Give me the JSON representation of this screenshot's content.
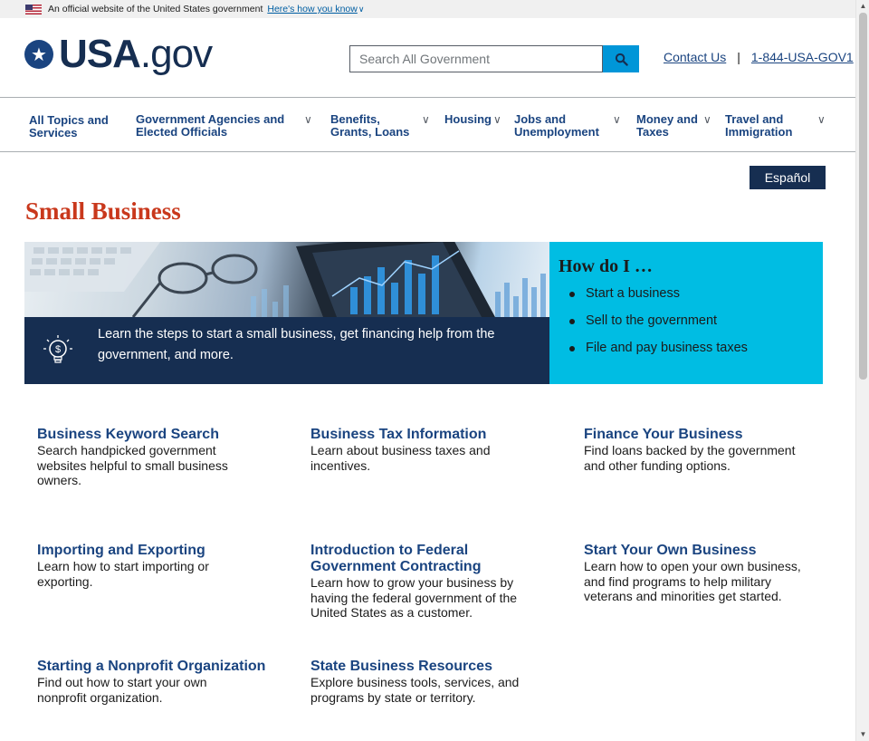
{
  "gov_banner": {
    "text": "An official website of the United States government",
    "link": "Here's how you know",
    "chevron_icon": "chevron-down-icon"
  },
  "header": {
    "logo_main": "USA",
    "logo_suffix": ".gov",
    "logo_icon": "star-circle-icon",
    "search": {
      "placeholder": "Search All Government",
      "value": "",
      "icon": "search-icon"
    },
    "contact_us": "Contact Us",
    "separator": "|",
    "phone": "1-844-USA-GOV1"
  },
  "nav": {
    "items": [
      {
        "label_line1": "All Topics and",
        "label_line2": "Services",
        "has_dropdown": false
      },
      {
        "label_line1": "Government Agencies and",
        "label_line2": "Elected Officials",
        "has_dropdown": true
      },
      {
        "label_line1": "Benefits,",
        "label_line2": "Grants, Loans",
        "has_dropdown": true
      },
      {
        "label_line1": "Housing",
        "label_line2": "",
        "has_dropdown": true
      },
      {
        "label_line1": "Jobs and",
        "label_line2": "Unemployment",
        "has_dropdown": true
      },
      {
        "label_line1": "Money and",
        "label_line2": "Taxes",
        "has_dropdown": true
      },
      {
        "label_line1": "Travel and",
        "label_line2": "Immigration",
        "has_dropdown": true
      }
    ]
  },
  "main": {
    "espanol_label": "Español",
    "page_title": "Small Business",
    "hero": {
      "caption_line1": "Learn the steps to start a small business, get financing help from the",
      "caption_line2": "government, and more.",
      "icon": "lightbulb-dollar-icon"
    },
    "how_do_i": {
      "heading": "How do I …",
      "items": [
        "Start a business",
        "Sell to the government",
        "File and pay business taxes"
      ]
    },
    "cards": [
      {
        "title": "Business Keyword Search",
        "desc": "Search handpicked government websites helpful to small business owners."
      },
      {
        "title": "Business Tax Information",
        "desc": "Learn about business taxes and incentives."
      },
      {
        "title": "Finance Your Business",
        "desc": "Find loans backed by the government and other funding options."
      },
      {
        "title": "Importing and Exporting",
        "desc": "Learn how to start importing or exporting."
      },
      {
        "title": "Introduction to Federal Government Contracting",
        "desc": "Learn how to grow your business by having the federal government of the United States as a customer."
      },
      {
        "title": "Start Your Own Business",
        "desc": "Learn how to open your own business, and find programs to help military veterans and minorities get started."
      },
      {
        "title": "Starting a Nonprofit Organization",
        "desc": "Find out how to start your own nonprofit organization."
      },
      {
        "title": "State Business Resources",
        "desc": "Explore business tools, services, and programs by state or territory."
      }
    ]
  },
  "colors": {
    "title_red": "#c9381c",
    "navy": "#162e51",
    "link_blue": "#1a4480",
    "cyan": "#00bde3"
  }
}
